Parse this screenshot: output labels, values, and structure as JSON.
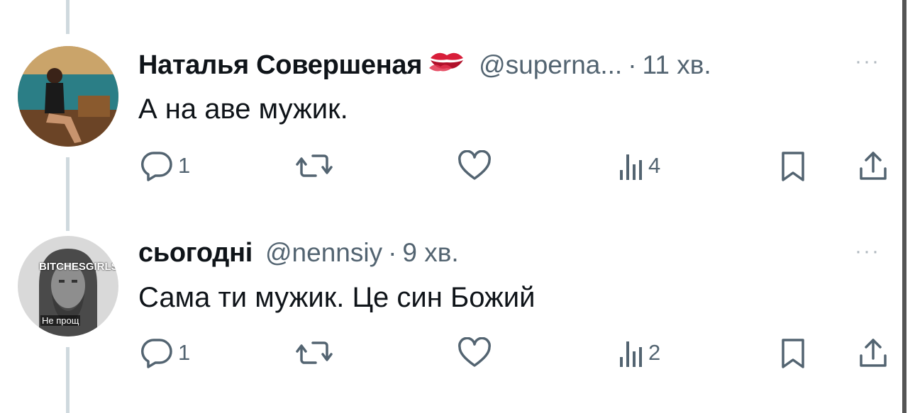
{
  "tweets": [
    {
      "name": "Наталья Совершеная",
      "name_emoji": "kiss-mark-emoji",
      "handle": "@superna...",
      "separator": "·",
      "time": "11 хв.",
      "text": "А на аве мужик.",
      "more": "···",
      "reply_count": "1",
      "views_count": "4"
    },
    {
      "name": "сьогодні",
      "handle": "@nennsiy",
      "separator": "·",
      "time": "9 хв.",
      "text": "Сама ти мужик. Це син Божий",
      "more": "···",
      "reply_count": "1",
      "views_count": "2",
      "avatar_overlay": {
        "watermark": "BITCHESGIRLS.COM",
        "caption": "Не прощ"
      }
    }
  ],
  "icons": [
    "reply-icon",
    "retweet-icon",
    "like-icon",
    "views-icon",
    "bookmark-icon",
    "share-icon"
  ],
  "colors": {
    "secondary_text": "#536471",
    "thread_line": "#cfd9de",
    "text": "#0f1419"
  }
}
